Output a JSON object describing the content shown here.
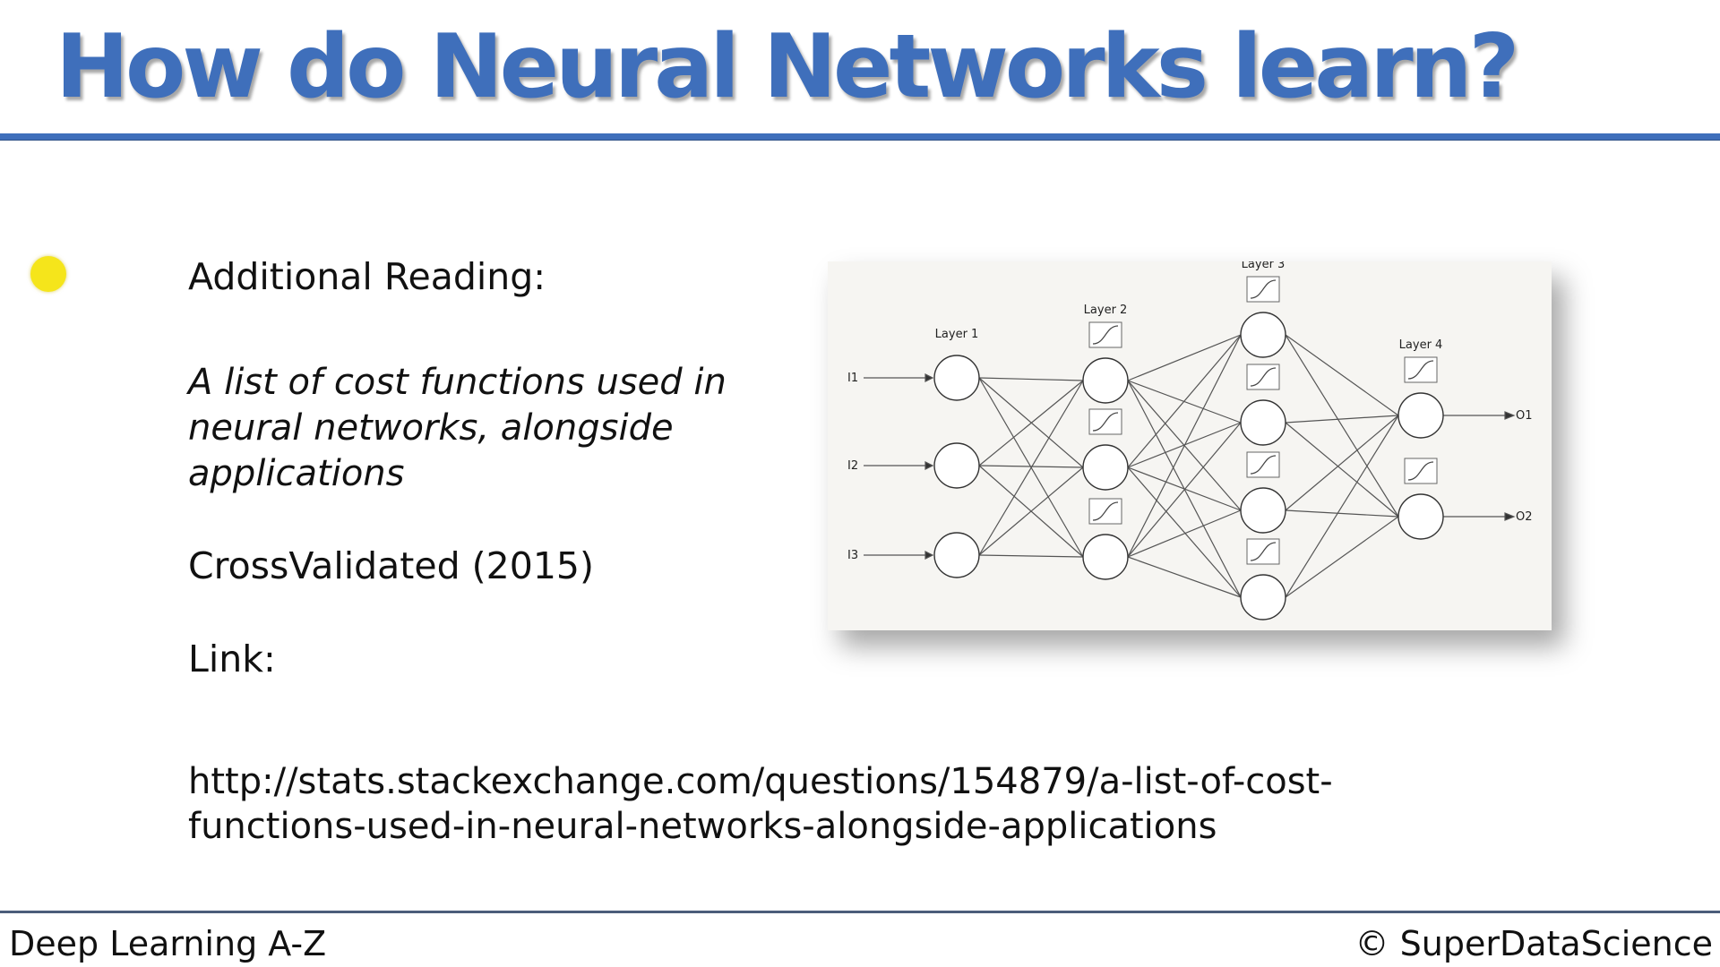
{
  "slide": {
    "title": "How do Neural Networks learn?",
    "reading_heading": "Additional Reading:",
    "article_title": "A list of cost functions used in neural networks, alongside applications",
    "source": "CrossValidated (2015)",
    "link_label": "Link:",
    "link_url": "http://stats.stackexchange.com/questions/154879/a-list-of-cost-functions-used-in-neural-networks-alongside-applications"
  },
  "diagram": {
    "layer_labels": [
      "Layer 1",
      "Layer 2",
      "Layer 3",
      "Layer 4"
    ],
    "inputs": [
      "I1",
      "I2",
      "I3"
    ],
    "outputs": [
      "O1",
      "O2"
    ]
  },
  "footer": {
    "course": "Deep Learning A-Z",
    "copyright": "© SuperDataScience"
  },
  "colors": {
    "title": "#3f6fbb",
    "rule": "#3f6fbb",
    "cursor": "#f5e51b"
  }
}
